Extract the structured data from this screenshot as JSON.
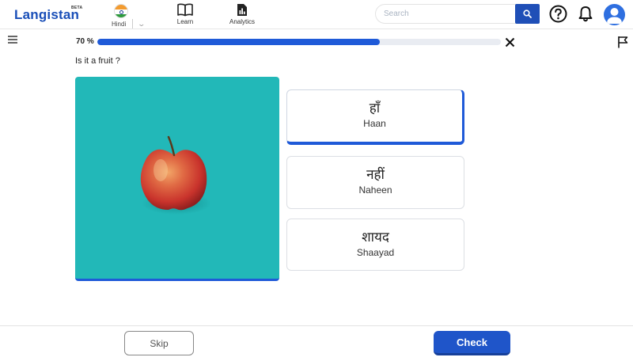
{
  "app": {
    "logo_text": "Langistan",
    "beta_label": "BETA"
  },
  "nav": {
    "language": "Hindi",
    "learn_label": "Learn",
    "analytics_label": "Analytics"
  },
  "search": {
    "placeholder": "Search",
    "value": ""
  },
  "icons": {
    "menu": "hamburger-icon",
    "close": "close-icon",
    "report": "flag-icon",
    "help": "question-circle-icon",
    "notifications": "bell-icon",
    "profile": "avatar-icon",
    "learn": "book-icon",
    "analytics": "chart-document-icon",
    "search": "magnifier-icon"
  },
  "quiz": {
    "progress_text": "70 %",
    "progress_value": 0.7,
    "question": "Is it a fruit ?",
    "image": "apple on teal background",
    "options": [
      {
        "native": "हाँ",
        "roman": "Haan",
        "selected": true
      },
      {
        "native": "नहीं",
        "roman": "Naheen",
        "selected": false
      },
      {
        "native": "शायद",
        "roman": "Shaayad",
        "selected": false
      }
    ]
  },
  "footer": {
    "skip_label": "Skip",
    "check_label": "Check"
  },
  "colors": {
    "accent": "#1f55c9",
    "progress": "#1f5ad8",
    "image_bg": "#22b8b8"
  }
}
